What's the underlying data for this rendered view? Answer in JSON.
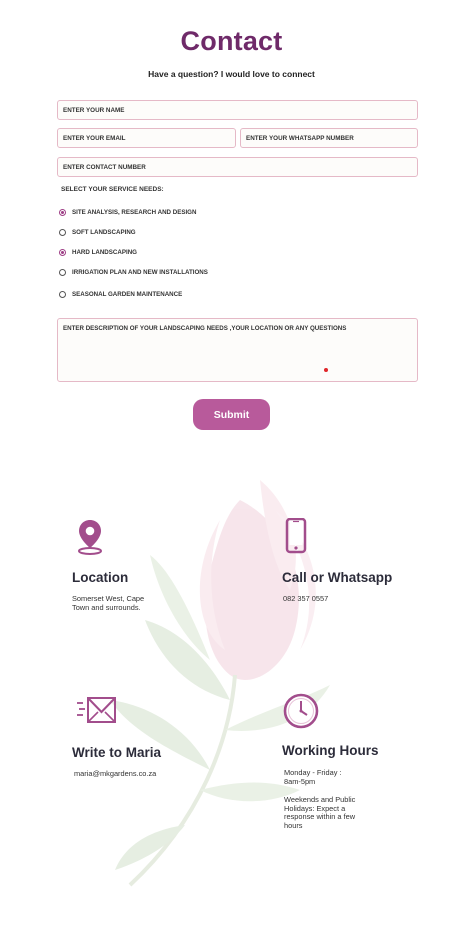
{
  "header": {
    "title": "Contact",
    "subtitle": "Have a question? I would love to connect"
  },
  "form": {
    "name_placeholder": "ENTER YOUR NAME",
    "email_placeholder": "ENTER YOUR EMAIL",
    "whatsapp_placeholder": "ENTER YOUR WHATSAPP NUMBER",
    "contact_placeholder": "ENTER CONTACT NUMBER",
    "services_label": "SELECT YOUR SERVICE NEEDS:",
    "services": [
      {
        "label": "SITE ANALYSIS, RESEARCH AND DESIGN",
        "selected": true
      },
      {
        "label": "SOFT LANDSCAPING",
        "selected": false
      },
      {
        "label": "HARD LANDSCAPING",
        "selected": true
      },
      {
        "label": "IRRIGATION PLAN AND NEW INSTALLATIONS",
        "selected": false
      },
      {
        "label": "SEASONAL GARDEN MAINTENANCE",
        "selected": false
      }
    ],
    "description_placeholder": "ENTER DESCRIPTION OF YOUR LANDSCAPING NEEDS ,YOUR LOCATION OR ANY QUESTIONS",
    "submit_label": "Submit"
  },
  "info": {
    "location": {
      "title": "Location",
      "text": "Somerset West, Cape Town and surrounds."
    },
    "call": {
      "title": "Call or Whatsapp",
      "text": "082 357 0557"
    },
    "write": {
      "title": "Write to Maria",
      "text": "maria@mkgardens.co.za"
    },
    "hours": {
      "title": "Working Hours",
      "text_1": "Monday - Friday : 8am-5pm",
      "text_2": "Weekends and Public Holidays: Expect a response within a few hours"
    }
  },
  "colors": {
    "accent": "#6f2a69",
    "button": "#b85a9b",
    "icon": "#a24d8c",
    "field_border": "#e5b9c7"
  }
}
